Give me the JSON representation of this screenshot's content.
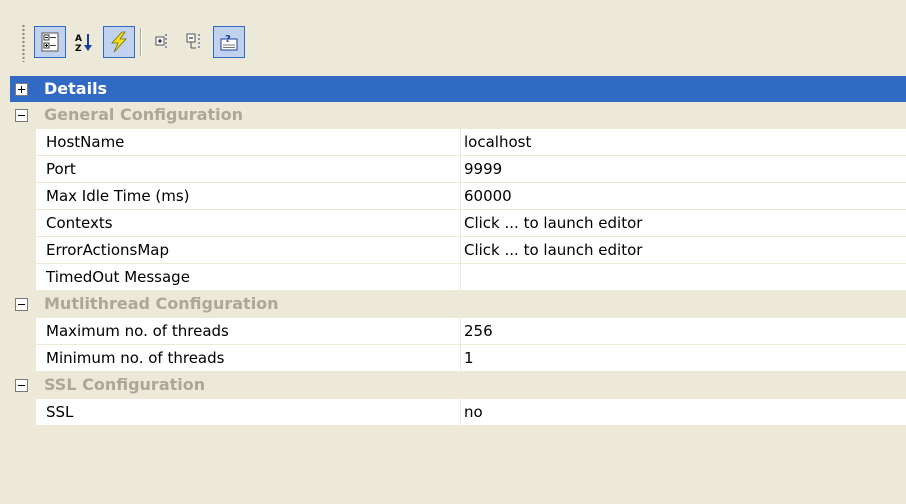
{
  "toolbar": {
    "buttons": [
      {
        "name": "categorized",
        "icon": "categorized-view-icon",
        "checked": true
      },
      {
        "name": "alphabetical",
        "icon": "sort-alphabetical-icon",
        "checked": false
      },
      {
        "name": "events",
        "icon": "lightning-events-icon",
        "checked": true
      },
      {
        "name": "expand-all",
        "icon": "expand-all-icon",
        "checked": false
      },
      {
        "name": "collapse-all",
        "icon": "collapse-all-icon",
        "checked": false
      },
      {
        "name": "help",
        "icon": "help-description-icon",
        "checked": true
      }
    ]
  },
  "colors": {
    "selection": "#316ac5",
    "category_text": "#aca899",
    "background": "#ece9d8"
  },
  "grid": {
    "details": {
      "label": "Details",
      "expanded": false
    },
    "general": {
      "label": "General Configuration",
      "expanded": true,
      "props": [
        {
          "name": "HostName",
          "value": "localhost"
        },
        {
          "name": "Port",
          "value": "9999"
        },
        {
          "name": "Max Idle Time (ms)",
          "value": "60000"
        },
        {
          "name": "Contexts",
          "value": "Click ... to launch editor"
        },
        {
          "name": "ErrorActionsMap",
          "value": "Click ... to launch editor"
        },
        {
          "name": "TimedOut Message",
          "value": ""
        }
      ]
    },
    "multithread": {
      "label": "Mutlithread Configuration",
      "expanded": true,
      "props": [
        {
          "name": "Maximum no. of threads",
          "value": "256"
        },
        {
          "name": "Minimum no. of threads",
          "value": "1"
        }
      ]
    },
    "ssl": {
      "label": "SSL Configuration",
      "expanded": true,
      "props": [
        {
          "name": "SSL",
          "value": "no"
        }
      ]
    }
  }
}
